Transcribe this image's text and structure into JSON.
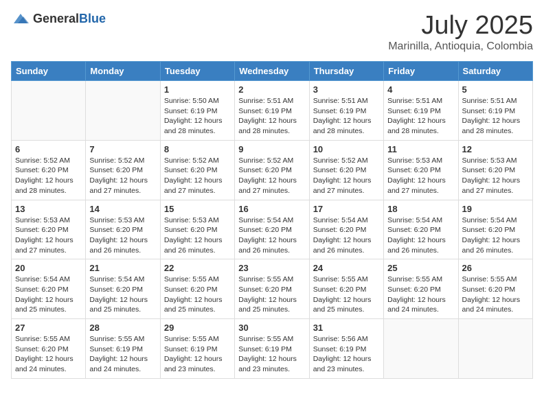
{
  "header": {
    "logo_general": "General",
    "logo_blue": "Blue",
    "month": "July 2025",
    "location": "Marinilla, Antioquia, Colombia"
  },
  "days_of_week": [
    "Sunday",
    "Monday",
    "Tuesday",
    "Wednesday",
    "Thursday",
    "Friday",
    "Saturday"
  ],
  "weeks": [
    [
      {
        "day": "",
        "info": ""
      },
      {
        "day": "",
        "info": ""
      },
      {
        "day": "1",
        "info": "Sunrise: 5:50 AM\nSunset: 6:19 PM\nDaylight: 12 hours and 28 minutes."
      },
      {
        "day": "2",
        "info": "Sunrise: 5:51 AM\nSunset: 6:19 PM\nDaylight: 12 hours and 28 minutes."
      },
      {
        "day": "3",
        "info": "Sunrise: 5:51 AM\nSunset: 6:19 PM\nDaylight: 12 hours and 28 minutes."
      },
      {
        "day": "4",
        "info": "Sunrise: 5:51 AM\nSunset: 6:19 PM\nDaylight: 12 hours and 28 minutes."
      },
      {
        "day": "5",
        "info": "Sunrise: 5:51 AM\nSunset: 6:19 PM\nDaylight: 12 hours and 28 minutes."
      }
    ],
    [
      {
        "day": "6",
        "info": "Sunrise: 5:52 AM\nSunset: 6:20 PM\nDaylight: 12 hours and 28 minutes."
      },
      {
        "day": "7",
        "info": "Sunrise: 5:52 AM\nSunset: 6:20 PM\nDaylight: 12 hours and 27 minutes."
      },
      {
        "day": "8",
        "info": "Sunrise: 5:52 AM\nSunset: 6:20 PM\nDaylight: 12 hours and 27 minutes."
      },
      {
        "day": "9",
        "info": "Sunrise: 5:52 AM\nSunset: 6:20 PM\nDaylight: 12 hours and 27 minutes."
      },
      {
        "day": "10",
        "info": "Sunrise: 5:52 AM\nSunset: 6:20 PM\nDaylight: 12 hours and 27 minutes."
      },
      {
        "day": "11",
        "info": "Sunrise: 5:53 AM\nSunset: 6:20 PM\nDaylight: 12 hours and 27 minutes."
      },
      {
        "day": "12",
        "info": "Sunrise: 5:53 AM\nSunset: 6:20 PM\nDaylight: 12 hours and 27 minutes."
      }
    ],
    [
      {
        "day": "13",
        "info": "Sunrise: 5:53 AM\nSunset: 6:20 PM\nDaylight: 12 hours and 27 minutes."
      },
      {
        "day": "14",
        "info": "Sunrise: 5:53 AM\nSunset: 6:20 PM\nDaylight: 12 hours and 26 minutes."
      },
      {
        "day": "15",
        "info": "Sunrise: 5:53 AM\nSunset: 6:20 PM\nDaylight: 12 hours and 26 minutes."
      },
      {
        "day": "16",
        "info": "Sunrise: 5:54 AM\nSunset: 6:20 PM\nDaylight: 12 hours and 26 minutes."
      },
      {
        "day": "17",
        "info": "Sunrise: 5:54 AM\nSunset: 6:20 PM\nDaylight: 12 hours and 26 minutes."
      },
      {
        "day": "18",
        "info": "Sunrise: 5:54 AM\nSunset: 6:20 PM\nDaylight: 12 hours and 26 minutes."
      },
      {
        "day": "19",
        "info": "Sunrise: 5:54 AM\nSunset: 6:20 PM\nDaylight: 12 hours and 26 minutes."
      }
    ],
    [
      {
        "day": "20",
        "info": "Sunrise: 5:54 AM\nSunset: 6:20 PM\nDaylight: 12 hours and 25 minutes."
      },
      {
        "day": "21",
        "info": "Sunrise: 5:54 AM\nSunset: 6:20 PM\nDaylight: 12 hours and 25 minutes."
      },
      {
        "day": "22",
        "info": "Sunrise: 5:55 AM\nSunset: 6:20 PM\nDaylight: 12 hours and 25 minutes."
      },
      {
        "day": "23",
        "info": "Sunrise: 5:55 AM\nSunset: 6:20 PM\nDaylight: 12 hours and 25 minutes."
      },
      {
        "day": "24",
        "info": "Sunrise: 5:55 AM\nSunset: 6:20 PM\nDaylight: 12 hours and 25 minutes."
      },
      {
        "day": "25",
        "info": "Sunrise: 5:55 AM\nSunset: 6:20 PM\nDaylight: 12 hours and 24 minutes."
      },
      {
        "day": "26",
        "info": "Sunrise: 5:55 AM\nSunset: 6:20 PM\nDaylight: 12 hours and 24 minutes."
      }
    ],
    [
      {
        "day": "27",
        "info": "Sunrise: 5:55 AM\nSunset: 6:20 PM\nDaylight: 12 hours and 24 minutes."
      },
      {
        "day": "28",
        "info": "Sunrise: 5:55 AM\nSunset: 6:19 PM\nDaylight: 12 hours and 24 minutes."
      },
      {
        "day": "29",
        "info": "Sunrise: 5:55 AM\nSunset: 6:19 PM\nDaylight: 12 hours and 23 minutes."
      },
      {
        "day": "30",
        "info": "Sunrise: 5:55 AM\nSunset: 6:19 PM\nDaylight: 12 hours and 23 minutes."
      },
      {
        "day": "31",
        "info": "Sunrise: 5:56 AM\nSunset: 6:19 PM\nDaylight: 12 hours and 23 minutes."
      },
      {
        "day": "",
        "info": ""
      },
      {
        "day": "",
        "info": ""
      }
    ]
  ]
}
